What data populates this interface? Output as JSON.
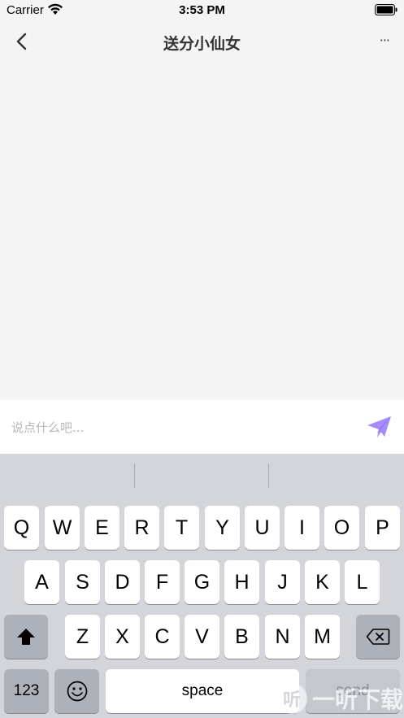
{
  "status_bar": {
    "carrier": "Carrier",
    "time": "3:53 PM"
  },
  "nav": {
    "title": "送分小仙女",
    "more_label": "···"
  },
  "input": {
    "placeholder": "说点什么吧..."
  },
  "colors": {
    "send_accent": "#a78bfa",
    "background": "#f4f4f4",
    "keyboard_bg": "#d3d5db"
  },
  "keyboard": {
    "row1": [
      "Q",
      "W",
      "E",
      "R",
      "T",
      "Y",
      "U",
      "I",
      "O",
      "P"
    ],
    "row2": [
      "A",
      "S",
      "D",
      "F",
      "G",
      "H",
      "J",
      "K",
      "L"
    ],
    "row3": [
      "Z",
      "X",
      "C",
      "V",
      "B",
      "N",
      "M"
    ],
    "numbers_label": "123",
    "space_label": "space",
    "send_label": "send"
  },
  "watermark": {
    "text": "一听下载",
    "logo_glyph": "听"
  }
}
